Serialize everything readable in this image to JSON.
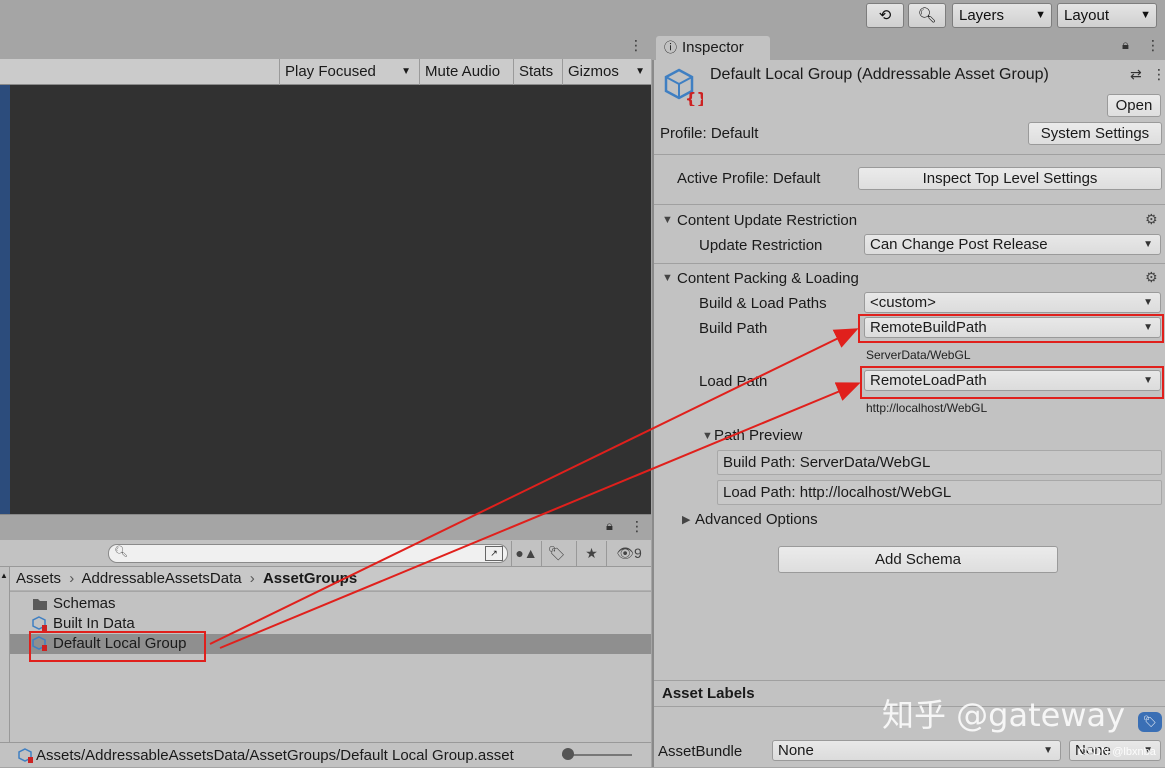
{
  "toolbar": {
    "layers_label": "Layers",
    "layout_label": "Layout"
  },
  "game": {
    "play_focused": "Play Focused",
    "mute_audio": "Mute Audio",
    "stats": "Stats",
    "gizmos": "Gizmos"
  },
  "project": {
    "search_placeholder": "",
    "hidden_count": "9",
    "breadcrumb": [
      "Assets",
      "AddressableAssetsData",
      "AssetGroups"
    ],
    "items": [
      {
        "label": "Schemas"
      },
      {
        "label": "Built In Data"
      },
      {
        "label": "Default Local Group"
      }
    ],
    "status_path": "Assets/AddressableAssetsData/AssetGroups/Default Local Group.asset"
  },
  "inspector": {
    "tab_label": "Inspector",
    "asset_title": "Default Local Group (Addressable Asset Group)",
    "open_label": "Open",
    "profile_label": "Profile: Default",
    "system_settings_label": "System Settings",
    "active_profile_label": "Active Profile: Default",
    "inspect_top_label": "Inspect Top Level Settings",
    "content_update": {
      "title": "Content Update Restriction",
      "update_restriction_label": "Update Restriction",
      "update_restriction_value": "Can Change Post Release"
    },
    "content_packing": {
      "title": "Content Packing & Loading",
      "build_load_paths_label": "Build & Load Paths",
      "build_load_paths_value": "<custom>",
      "build_path_label": "Build Path",
      "build_path_value": "RemoteBuildPath",
      "build_path_hint": "ServerData/WebGL",
      "load_path_label": "Load Path",
      "load_path_value": "RemoteLoadPath",
      "load_path_hint": "http://localhost/WebGL",
      "path_preview_label": "Path Preview",
      "preview_build": "Build Path: ServerData/WebGL",
      "preview_load": "Load Path: http://localhost/WebGL",
      "advanced_label": "Advanced Options"
    },
    "add_schema_label": "Add Schema",
    "asset_labels_title": "Asset Labels",
    "asset_bundle_label": "AssetBundle",
    "asset_bundle_value": "None",
    "asset_bundle_variant": "None"
  },
  "watermark": {
    "text": "知乎 @gateway",
    "small": "CSDN @lbxnba"
  },
  "colors": {
    "highlight_red": "#e0201c",
    "game_bg": "#313131",
    "panel_bg": "#c2c2c2"
  }
}
